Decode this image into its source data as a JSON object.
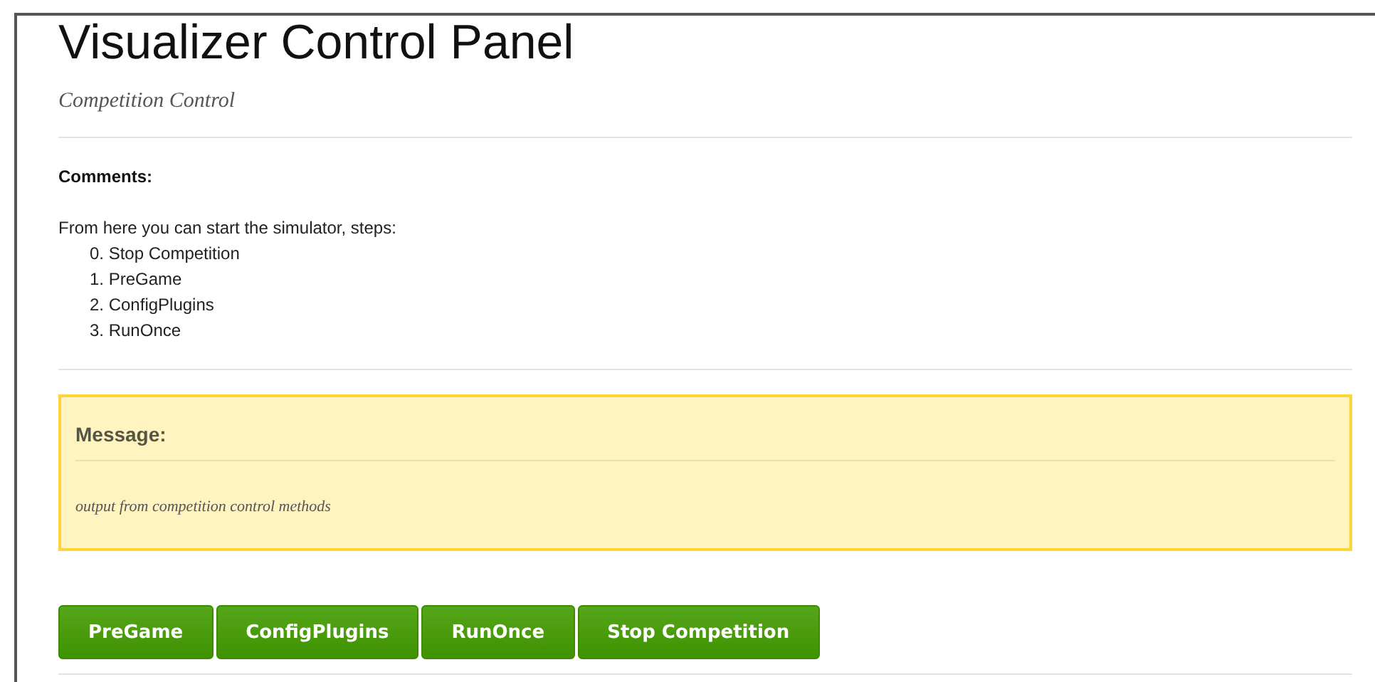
{
  "title": "Visualizer Control Panel",
  "subtitle": "Competition Control",
  "comments": {
    "heading": "Comments:",
    "intro": "From here you can start the simulator, steps:",
    "steps": [
      "0. Stop Competition",
      "1. PreGame",
      "2. ConfigPlugins",
      "3. RunOnce"
    ]
  },
  "message": {
    "heading": "Message:",
    "body": "output from competition control methods"
  },
  "buttons": [
    "PreGame",
    "ConfigPlugins",
    "RunOnce",
    "Stop Competition"
  ]
}
